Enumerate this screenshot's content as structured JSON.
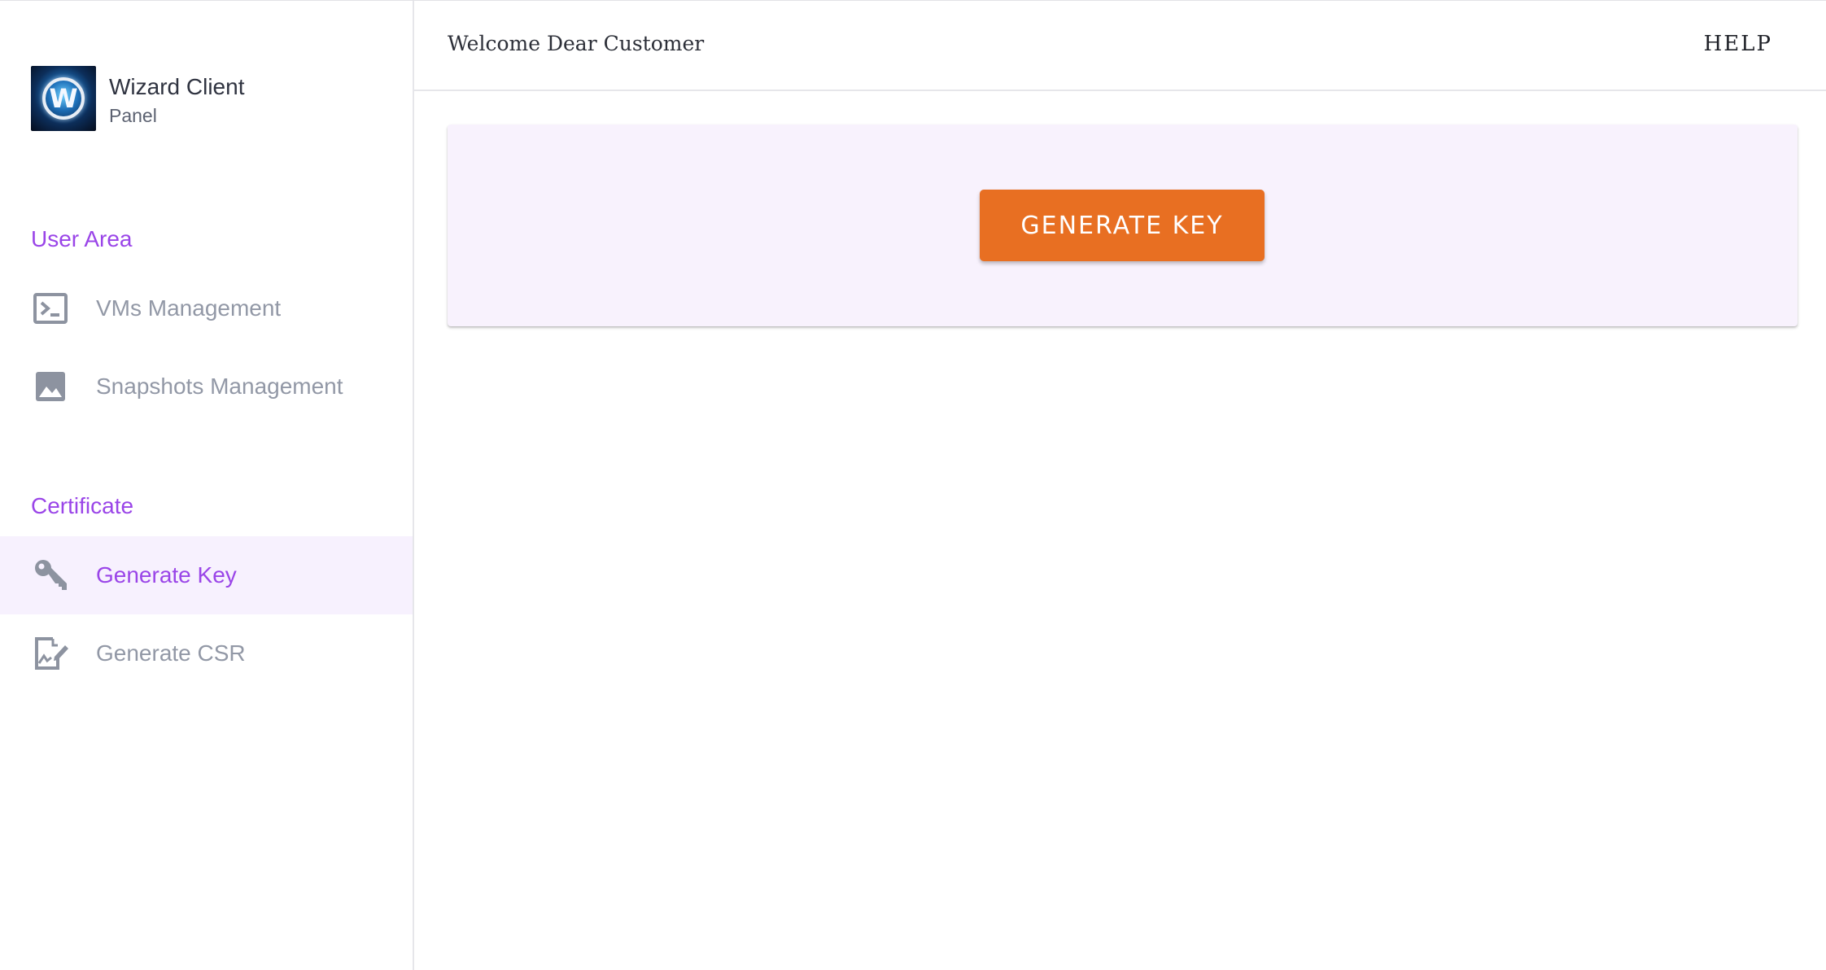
{
  "brand": {
    "title": "Wizard Client",
    "subtitle": "Panel",
    "logo_letter": "W"
  },
  "sidebar": {
    "sections": [
      {
        "label": "User Area",
        "items": [
          {
            "label": "VMs Management",
            "icon": "terminal-icon"
          },
          {
            "label": "Snapshots Management",
            "icon": "image-icon"
          }
        ]
      },
      {
        "label": "Certificate",
        "items": [
          {
            "label": "Generate Key",
            "icon": "key-icon",
            "active": true
          },
          {
            "label": "Generate CSR",
            "icon": "signature-document-icon"
          }
        ]
      }
    ]
  },
  "header": {
    "welcome": "Welcome Dear Customer",
    "help": "HELP"
  },
  "main": {
    "button_label": "GENERATE KEY"
  },
  "colors": {
    "accent": "#9a45e8",
    "button": "#e86f22",
    "active_bg": "#f7f1fe",
    "card_bg": "#f8f2fd",
    "muted_text": "#9298a6"
  }
}
